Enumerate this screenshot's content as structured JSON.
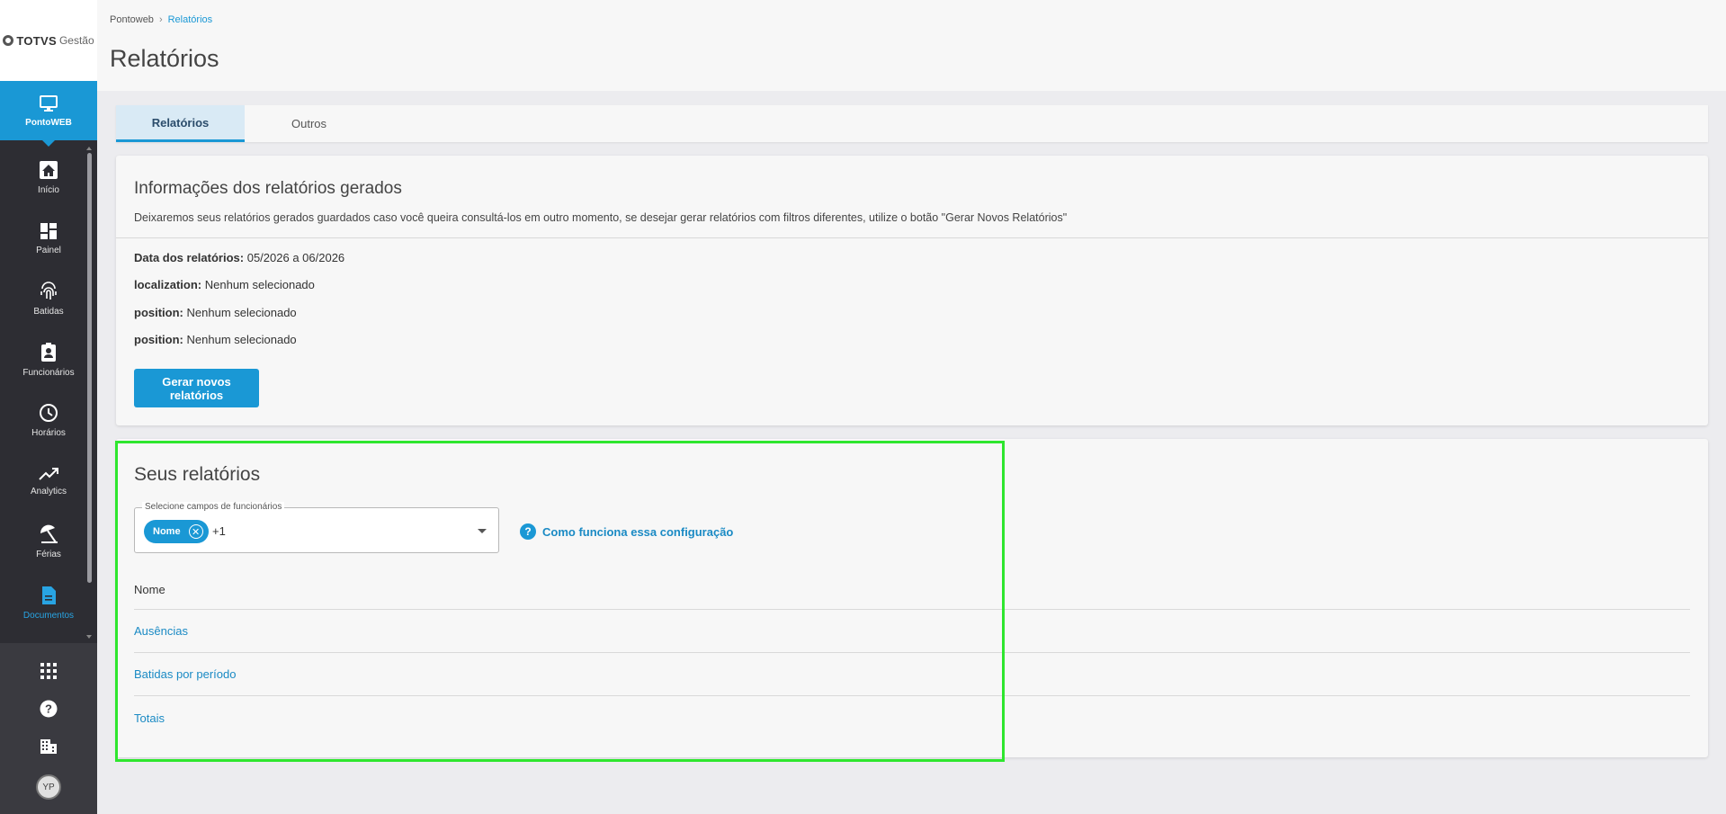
{
  "app": {
    "logo_brand": "TOTVS",
    "logo_sub": "Gestão"
  },
  "sidebar": {
    "active": {
      "label": "PontoWEB",
      "icon": "monitor-icon"
    },
    "items": [
      {
        "label": "Início",
        "icon": "home-icon"
      },
      {
        "label": "Painel",
        "icon": "dashboard-icon"
      },
      {
        "label": "Batidas",
        "icon": "fingerprint-icon"
      },
      {
        "label": "Funcionários",
        "icon": "badge-icon"
      },
      {
        "label": "Horários",
        "icon": "clock-icon"
      },
      {
        "label": "Analytics",
        "icon": "trending-up-icon"
      },
      {
        "label": "Férias",
        "icon": "beach-umbrella-icon"
      },
      {
        "label": "Documentos",
        "icon": "document-icon"
      }
    ],
    "bottom": {
      "avatar_initials": "YP"
    }
  },
  "header": {
    "breadcrumb": {
      "root": "Pontoweb",
      "current": "Relatórios"
    },
    "title": "Relatórios"
  },
  "tabs": [
    {
      "label": "Relatórios",
      "active": true
    },
    {
      "label": "Outros",
      "active": false
    }
  ],
  "info": {
    "title": "Informações dos relatórios gerados",
    "description": "Deixaremos seus relatórios gerados guardados caso você queira consultá-los em outro momento, se desejar gerar relatórios com filtros diferentes, utilize o botão \"Gerar Novos Relatórios\"",
    "rows": [
      {
        "label": "Data dos relatórios:",
        "value": "05/2026 a 06/2026"
      },
      {
        "label": "localization:",
        "value": "Nenhum selecionado"
      },
      {
        "label": "position:",
        "value": "Nenhum selecionado"
      },
      {
        "label": "position:",
        "value": "Nenhum selecionado"
      }
    ],
    "button_label": "Gerar novos relatórios"
  },
  "reports": {
    "title": "Seus relatórios",
    "select": {
      "legend": "Selecione campos de funcionários",
      "chip": "Nome",
      "extra_count": "+1"
    },
    "help_link": "Como funciona essa configuração",
    "column_header": "Nome",
    "items": [
      "Ausências",
      "Batidas por período",
      "Totais"
    ]
  },
  "colors": {
    "primary": "#1a98d5",
    "sidebar_bg": "#2d2d33",
    "highlight": "#2ee62e"
  }
}
